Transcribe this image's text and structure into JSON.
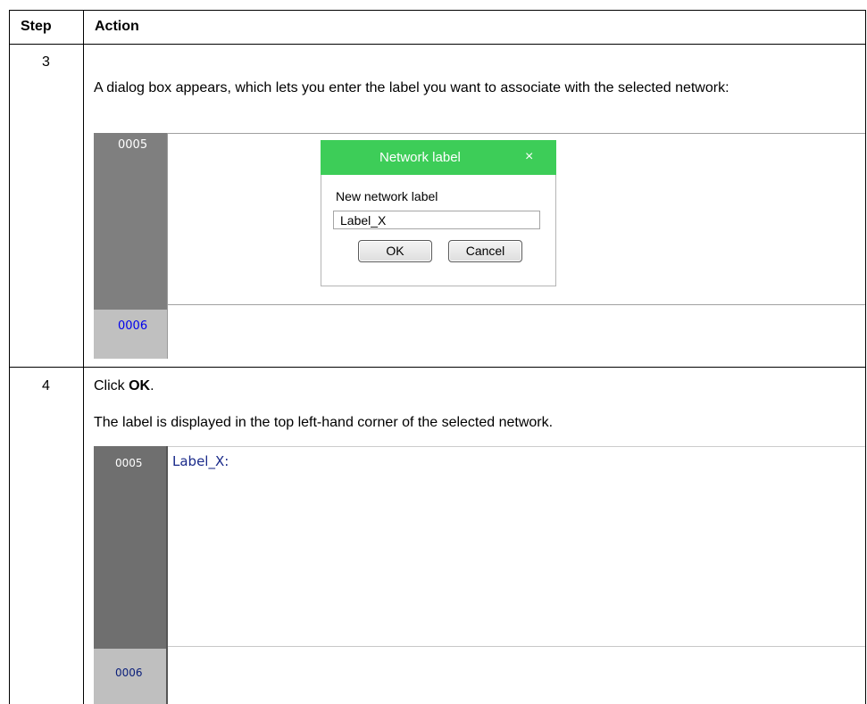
{
  "table": {
    "headers": {
      "step": "Step",
      "action": "Action"
    },
    "rows": [
      {
        "step": "3",
        "intro": "A dialog box appears, which lets you enter the label you want to associate with the selected network:",
        "screenshot": {
          "network_1": "0005",
          "network_2": "0006",
          "dialog": {
            "title": "Network label",
            "close_glyph": "×",
            "field_label": "New network label",
            "field_value": "Label_X",
            "ok_label": "OK",
            "cancel_label": "Cancel",
            "title_color": "#3dcd58"
          }
        }
      },
      {
        "step": "4",
        "click_prefix": "Click ",
        "click_bold": "OK",
        "click_suffix": ".",
        "result": "The label is displayed in the top left-hand corner of the selected network.",
        "screenshot": {
          "network_1": "0005",
          "network_2": "0006",
          "label_text": "Label_X:"
        }
      }
    ]
  }
}
